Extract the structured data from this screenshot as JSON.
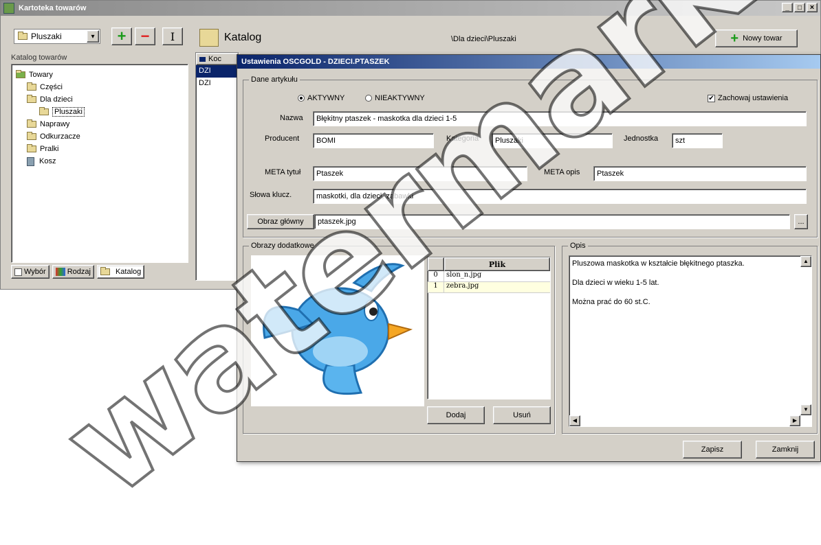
{
  "main_window": {
    "title": "Kartoteka towarów",
    "controls": [
      "_",
      "□",
      "×"
    ]
  },
  "left": {
    "dropdown_value": "Pluszaki",
    "dropdown_arrow": "▾",
    "add_label": "+",
    "remove_label": "−",
    "edit_label": "I",
    "tree_header": "Katalog towarów",
    "tree": [
      {
        "label": "Towary",
        "level": 0
      },
      {
        "label": "Części",
        "level": 1
      },
      {
        "label": "Dla dzieci",
        "level": 1
      },
      {
        "label": "Pluszaki",
        "level": 2
      },
      {
        "label": "Naprawy",
        "level": 1
      },
      {
        "label": "Odkurzacze",
        "level": 1
      },
      {
        "label": "Pralki",
        "level": 1
      },
      {
        "label": "Kosz",
        "level": 1
      }
    ],
    "tabs": [
      {
        "label": "Wybór"
      },
      {
        "label": "Rodzaj"
      },
      {
        "label": "Katalog"
      }
    ]
  },
  "catalog": {
    "title": "Katalog",
    "path": "\\Dla dzieci\\Pluszaki",
    "new_button": "Nowy towar",
    "new_icon": "+",
    "list_header": "Koc",
    "rows": [
      "DZI",
      "DZI"
    ]
  },
  "dialog": {
    "title": "Ustawienia OSCGOLD - DZIECI.PTASZEK",
    "dane": {
      "group_label": "Dane artykułu",
      "radio_active": "AKTYWNY",
      "radio_inactive": "NIEAKTYWNY",
      "keep_settings": "Zachowaj ustawienia",
      "keep_checked": "✔",
      "nazwa_label": "Nazwa",
      "nazwa_value": "Błękitny ptaszek - maskotka dla dzieci 1-5",
      "producent_label": "Producent",
      "producent_value": "BOMI",
      "kategoria_label": "Kategoria",
      "kategoria_value": "Pluszaki",
      "jednostka_label": "Jednostka",
      "jednostka_value": "szt",
      "meta_title_label": "META tytuł",
      "meta_title_value": "Ptaszek",
      "meta_desc_label": "META opis",
      "meta_desc_value": "Ptaszek",
      "keywords_label": "Słowa klucz.",
      "keywords_value": "maskotki, dla dzieci, zabawki",
      "main_image_button": "Obraz główny",
      "main_image_value": "ptaszek.jpg",
      "browse_label": "..."
    },
    "images": {
      "group_label": "Obrazy dodatkowe",
      "col_header": "Plik",
      "rows": [
        {
          "idx": "0",
          "file": "slon_n.jpg"
        },
        {
          "idx": "1",
          "file": "zebra.jpg"
        }
      ],
      "add_button": "Dodaj",
      "remove_button": "Usuń"
    },
    "opis": {
      "group_label": "Opis",
      "lines": [
        "Pluszowa maskotka w kształcie błękitnego ptaszka.",
        "Dla dzieci w wieku 1-5 lat.",
        "Można prać do 60 st.C."
      ]
    },
    "footer": {
      "save_button": "Zapisz",
      "close_button": "Zamknij"
    }
  },
  "colors": {
    "bird": "#4aa8e8",
    "bird_dark": "#1f6fb0",
    "beak": "#f5a623",
    "selection": "#0a246a",
    "row_highlight": "#ffffe0"
  },
  "watermark": "watermark"
}
